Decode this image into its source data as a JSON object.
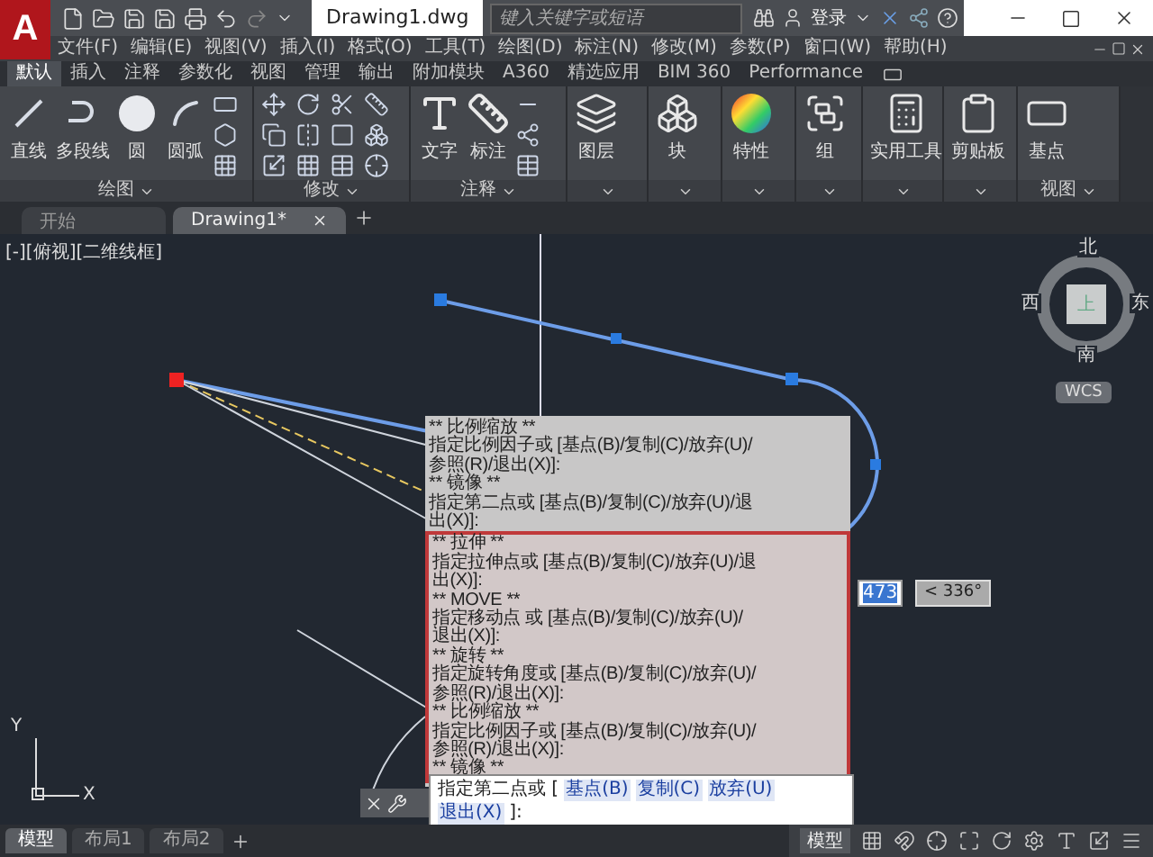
{
  "title_bar": {
    "app_logo": "A",
    "title": "Drawing1.dwg",
    "search": {
      "placeholder": "键入关键字或短语"
    },
    "sign_in": "登录"
  },
  "menu_bar": [
    "文件(F)",
    "编辑(E)",
    "视图(V)",
    "插入(I)",
    "格式(O)",
    "工具(T)",
    "绘图(D)",
    "标注(N)",
    "修改(M)",
    "参数(P)",
    "窗口(W)",
    "帮助(H)"
  ],
  "ribbon_tabs": [
    {
      "label": "默认",
      "selected": true
    },
    {
      "label": "插入",
      "selected": false
    },
    {
      "label": "注释",
      "selected": false
    },
    {
      "label": "参数化",
      "selected": false
    },
    {
      "label": "视图",
      "selected": false
    },
    {
      "label": "管理",
      "selected": false
    },
    {
      "label": "输出",
      "selected": false
    },
    {
      "label": "附加模块",
      "selected": false
    },
    {
      "label": "A360",
      "selected": false
    },
    {
      "label": "精选应用",
      "selected": false
    },
    {
      "label": "BIM 360",
      "selected": false
    },
    {
      "label": "Performance",
      "selected": false
    }
  ],
  "ribbon_panels": [
    {
      "kind": "draw",
      "title": "绘图",
      "tools": [
        "直线",
        "多段线",
        "圆",
        "圆弧"
      ]
    },
    {
      "kind": "modify",
      "title": "修改"
    },
    {
      "kind": "annotate",
      "title": "注释",
      "tools": [
        "文字",
        "标注"
      ]
    },
    {
      "kind": "single",
      "tools": [
        "图层"
      ]
    },
    {
      "kind": "single",
      "tools": [
        "块"
      ]
    },
    {
      "kind": "single",
      "tools": [
        "特性"
      ]
    },
    {
      "kind": "single",
      "tools": [
        "组"
      ]
    },
    {
      "kind": "single",
      "tools": [
        "实用工具"
      ]
    },
    {
      "kind": "single",
      "tools": [
        "剪贴板"
      ]
    },
    {
      "kind": "single",
      "title": "视图",
      "tools": [
        "基点"
      ]
    }
  ],
  "document_tabs": [
    {
      "label": "开始",
      "selected": false
    },
    {
      "label": "Drawing1*",
      "selected": true
    }
  ],
  "viewport": {
    "label": "[-][俯视][二维线框]",
    "compass": {
      "north": "北",
      "south": "南",
      "east": "东",
      "west": "西",
      "face": "上",
      "ucs_menu": "WCS"
    },
    "ucs_icon": {
      "x_label": "X",
      "y_label": "Y"
    },
    "dynamic_input": {
      "value": "473",
      "angle": "< 336°"
    }
  },
  "command_history": {
    "lines": [
      "** 比例缩放 **",
      "指定比例因子或 [基点(B)/复制(C)/放弃(U)/",
      "参照(R)/退出(X)]:",
      "** 镜像 **",
      "指定第二点或 [基点(B)/复制(C)/放弃(U)/退",
      "出(X)]:"
    ],
    "highlighted_lines": [
      "** 拉伸 **",
      "指定拉伸点或 [基点(B)/复制(C)/放弃(U)/退",
      "出(X)]:",
      "** MOVE **",
      "指定移动点 或 [基点(B)/复制(C)/放弃(U)/",
      "退出(X)]:",
      "** 旋转 **",
      "指定旋转角度或 [基点(B)/复制(C)/放弃(U)/",
      "参照(R)/退出(X)]:",
      "** 比例缩放 **",
      "指定比例因子或 [基点(B)/复制(C)/放弃(U)/",
      "参照(R)/退出(X)]:",
      "** 镜像 **"
    ]
  },
  "command_line": {
    "prompt": "指定第二点或 [",
    "options": [
      "基点(B)",
      "复制(C)",
      "放弃(U)",
      "退出(X)"
    ],
    "end": "]:"
  },
  "layout_tabs": [
    {
      "label": "模型",
      "selected": true
    },
    {
      "label": "布局1",
      "selected": false
    },
    {
      "label": "布局2",
      "selected": false
    }
  ],
  "status_bar": {
    "model_button": "模型"
  }
}
